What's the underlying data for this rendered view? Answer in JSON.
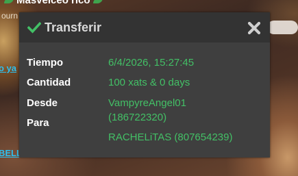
{
  "background": {
    "top_text": "Masvelceo rico",
    "sub_text": "ourn",
    "link_1": "o ya",
    "link_2": "BELL"
  },
  "dialog": {
    "title": "Transferir",
    "icon": "check-icon",
    "close_icon": "close-icon",
    "accent_color": "#43c066",
    "rows": {
      "time_label": "Tiempo",
      "time_value": "6/4/2026, 15:27:45",
      "amount_label": "Cantidad",
      "amount_value": "100 xats & 0 days",
      "from_label": "Desde",
      "from_value_line1": "VampyreAngel01",
      "from_value_line2": "(186722320)",
      "to_label": "Para",
      "to_value": "RACHELiTAS (807654239)"
    }
  }
}
